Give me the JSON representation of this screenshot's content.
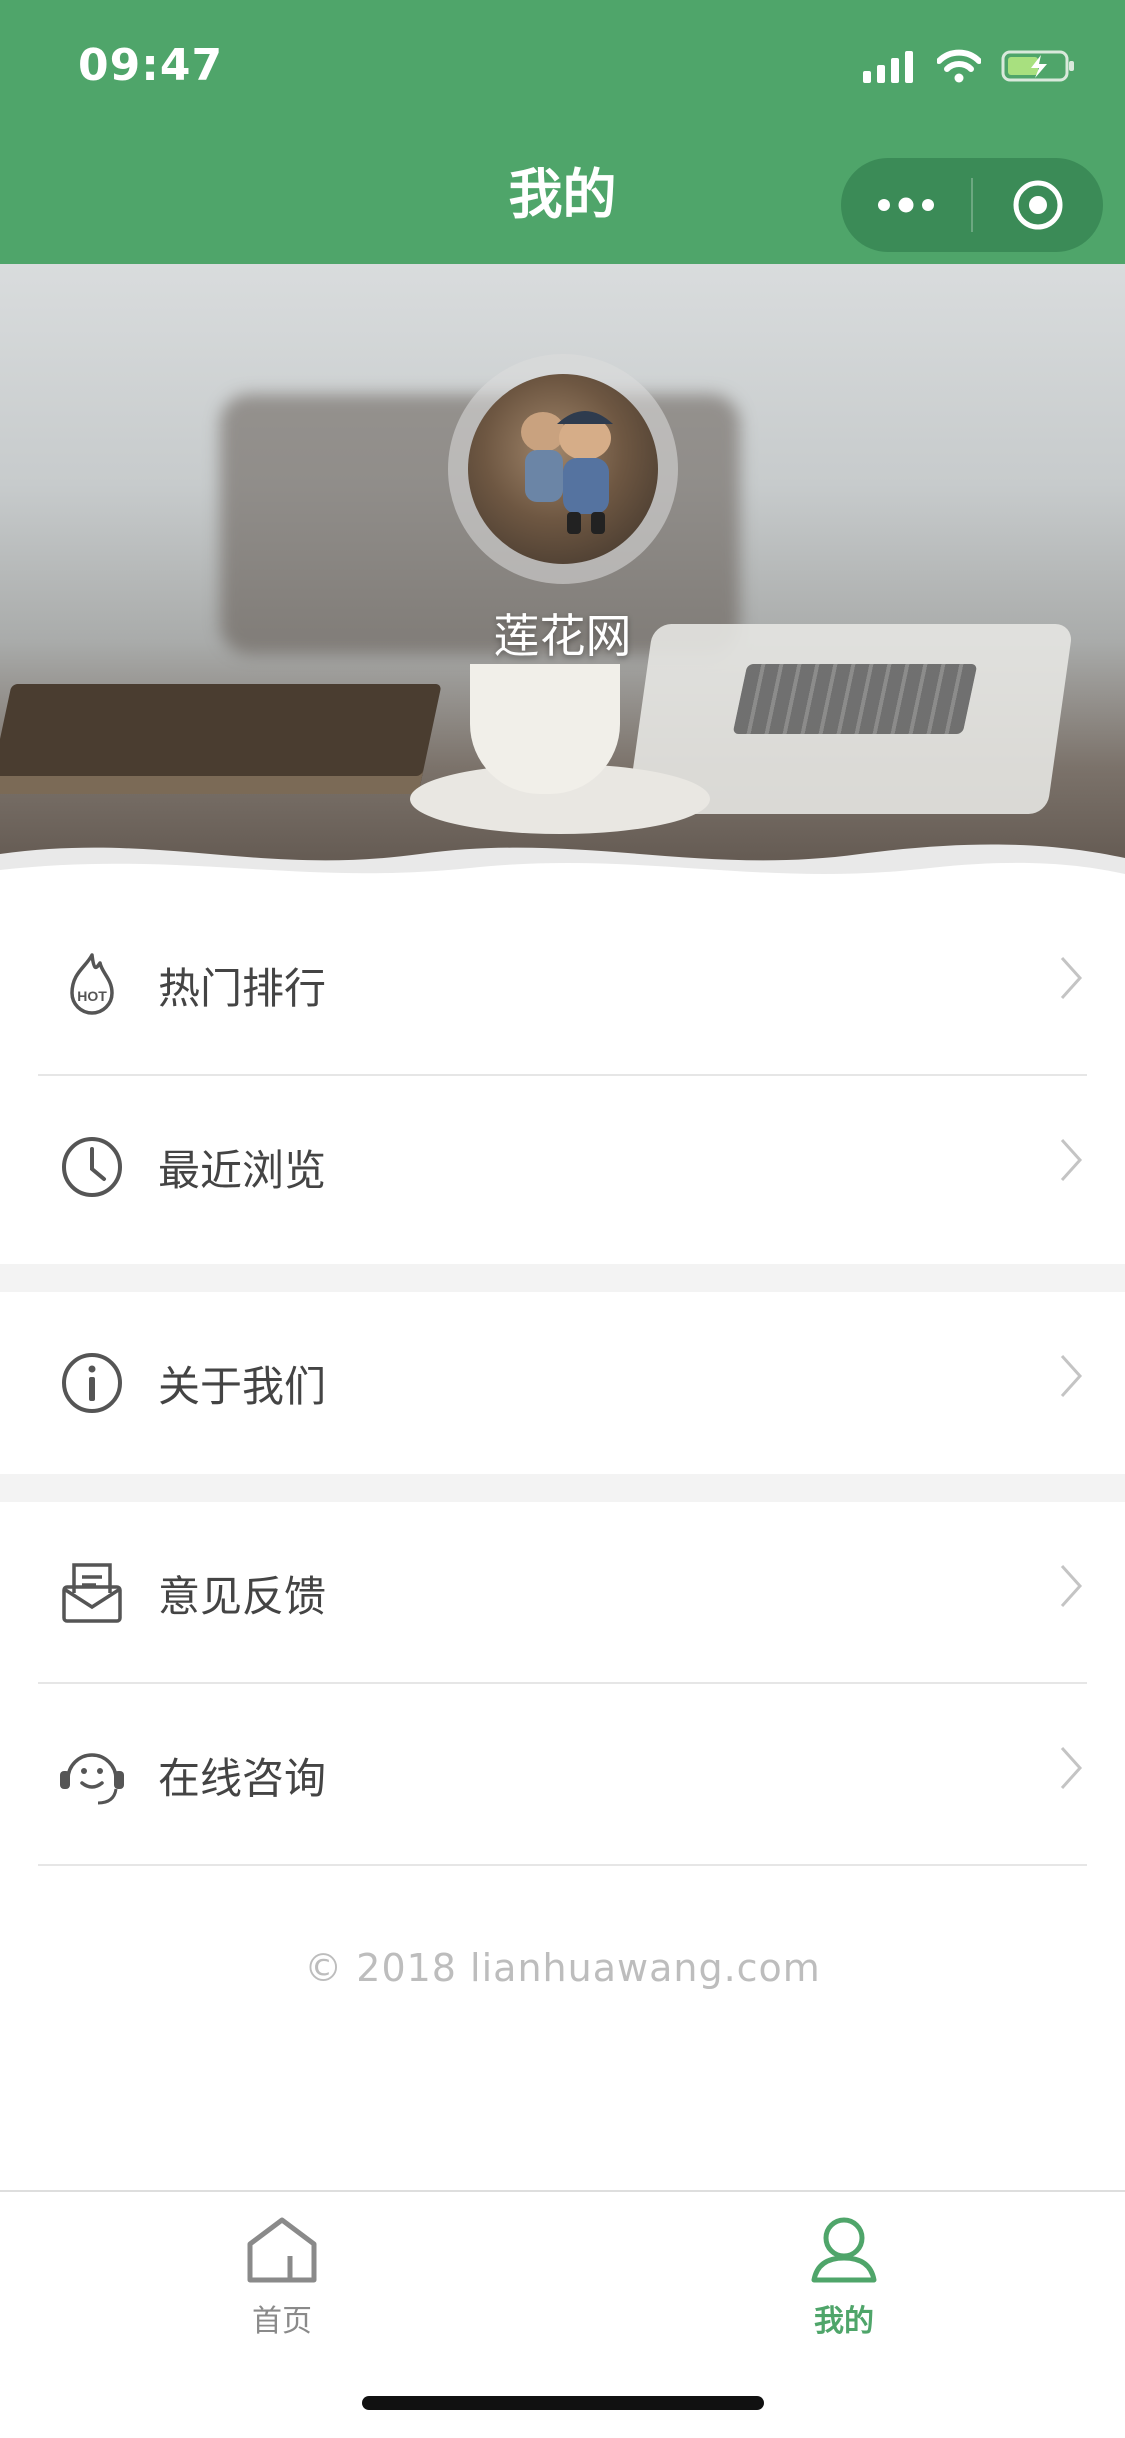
{
  "status_bar": {
    "time": "09:47"
  },
  "nav": {
    "title": "我的"
  },
  "hero": {
    "brand": "莲花网"
  },
  "menu": {
    "group1": [
      {
        "label": "热门排行",
        "icon": "hot-flame-icon"
      },
      {
        "label": "最近浏览",
        "icon": "clock-icon"
      }
    ],
    "group2": [
      {
        "label": "关于我们",
        "icon": "info-icon"
      }
    ],
    "group3": [
      {
        "label": "意见反馈",
        "icon": "mail-icon"
      },
      {
        "label": "在线咨询",
        "icon": "support-face-icon"
      }
    ]
  },
  "footer": {
    "copyright": "© 2018 lianhuawang.com"
  },
  "tabbar": {
    "tabs": [
      {
        "label": "首页",
        "icon": "home-icon",
        "active": false
      },
      {
        "label": "我的",
        "icon": "user-icon",
        "active": true
      }
    ]
  },
  "colors": {
    "brand": "#4fa56a",
    "capsule": "#3b8b57",
    "text": "#444444",
    "muted": "#bdbdbd"
  }
}
